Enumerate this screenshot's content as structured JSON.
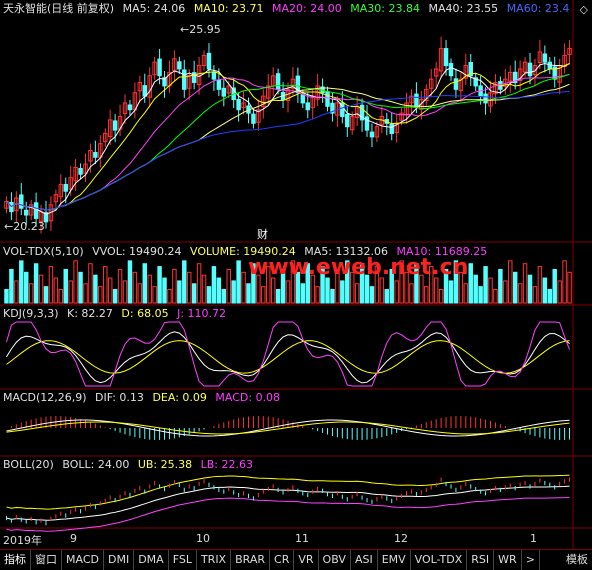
{
  "header": {
    "title": "天永智能(日线 前复权)",
    "ma5": "MA5: 24.06",
    "ma10": "MA10: 23.71",
    "ma20": "MA20: 24.00",
    "ma30": "MA30: 23.84",
    "ma40": "MA40: 23.55",
    "ma60": "MA60: 23.4",
    "settings_icon": "diamond-icon"
  },
  "price_annotations": {
    "high": "25.95",
    "low": "20.23",
    "event": "财"
  },
  "vol_header": {
    "name": "VOL-TDX(5,10)",
    "vvol": "VVOL: 19490.24",
    "volume": "VOLUME: 19490.24",
    "ma5": "MA5: 13132.06",
    "ma10": "MA10: 11689.25"
  },
  "kdj_header": {
    "name": "KDJ(9,3,3)",
    "k": "K: 82.27",
    "d": "D: 68.05",
    "j": "J: 110.72"
  },
  "macd_header": {
    "name": "MACD(12,26,9)",
    "dif": "DIF: 0.13",
    "dea": "DEA: 0.09",
    "macd": "MACD: 0.08"
  },
  "boll_header": {
    "name": "BOLL(20)",
    "boll": "BOLL: 24.00",
    "ub": "UB: 25.38",
    "lb": "LB: 22.63"
  },
  "x_axis": {
    "year": "2019年",
    "months": [
      "9",
      "10",
      "11",
      "12",
      "1"
    ]
  },
  "watermark": "www.eweb.net.cn",
  "tabs": [
    "指标",
    "窗口",
    "MACD",
    "DMI",
    "DMA",
    "FSL",
    "TRIX",
    "BRAR",
    "CR",
    "VR",
    "OBV",
    "ASI",
    "EMV",
    "VOL-TDX",
    "RSI",
    "WR",
    ">",
    "模板"
  ],
  "colors": {
    "up": "#ff3232",
    "down": "#54ffff",
    "ma5": "#ffffff",
    "ma10": "#ffff00",
    "ma20": "#ff40ff",
    "ma30": "#00ff00",
    "ma40": "#ffff80",
    "ma60": "#2040ff",
    "divider": "#800000"
  },
  "chart_data": {
    "type": "candlestick",
    "symbol": "天永智能",
    "period": "日线 前复权",
    "price_range": [
      20.23,
      25.95
    ],
    "close": [
      20.9,
      20.6,
      21.0,
      20.7,
      20.5,
      20.8,
      20.4,
      20.6,
      20.3,
      20.8,
      21.1,
      21.4,
      21.2,
      21.6,
      21.9,
      21.7,
      22.0,
      22.4,
      22.2,
      22.6,
      22.9,
      23.3,
      23.0,
      23.4,
      23.8,
      23.6,
      24.1,
      24.4,
      24.0,
      24.6,
      25.0,
      24.6,
      24.3,
      24.7,
      25.1,
      24.8,
      24.2,
      24.6,
      24.4,
      24.9,
      25.2,
      24.8,
      24.5,
      24.2,
      24.0,
      24.3,
      23.9,
      23.6,
      23.8,
      23.5,
      23.2,
      23.6,
      24.0,
      24.3,
      24.6,
      24.2,
      23.9,
      24.2,
      24.5,
      24.1,
      23.8,
      23.6,
      24.0,
      24.3,
      24.1,
      23.7,
      23.5,
      23.8,
      23.4,
      23.1,
      23.4,
      23.7,
      23.3,
      23.0,
      22.8,
      23.1,
      23.4,
      23.2,
      22.9,
      23.2,
      23.5,
      23.8,
      24.0,
      23.7,
      23.9,
      24.2,
      24.5,
      24.8,
      25.4,
      24.9,
      24.6,
      24.2,
      24.5,
      24.9,
      24.6,
      24.3,
      24.0,
      23.8,
      24.1,
      24.4,
      24.2,
      24.5,
      24.7,
      24.4,
      24.8,
      25.0,
      24.6,
      24.9,
      25.3,
      25.0,
      24.8,
      24.5,
      24.9,
      25.2,
      25.4
    ],
    "volume_series": [
      "VVOL",
      "MA5",
      "MA10"
    ],
    "indicators": [
      "KDJ(9,3,3)",
      "MACD(12,26,9)",
      "BOLL(20)"
    ]
  }
}
